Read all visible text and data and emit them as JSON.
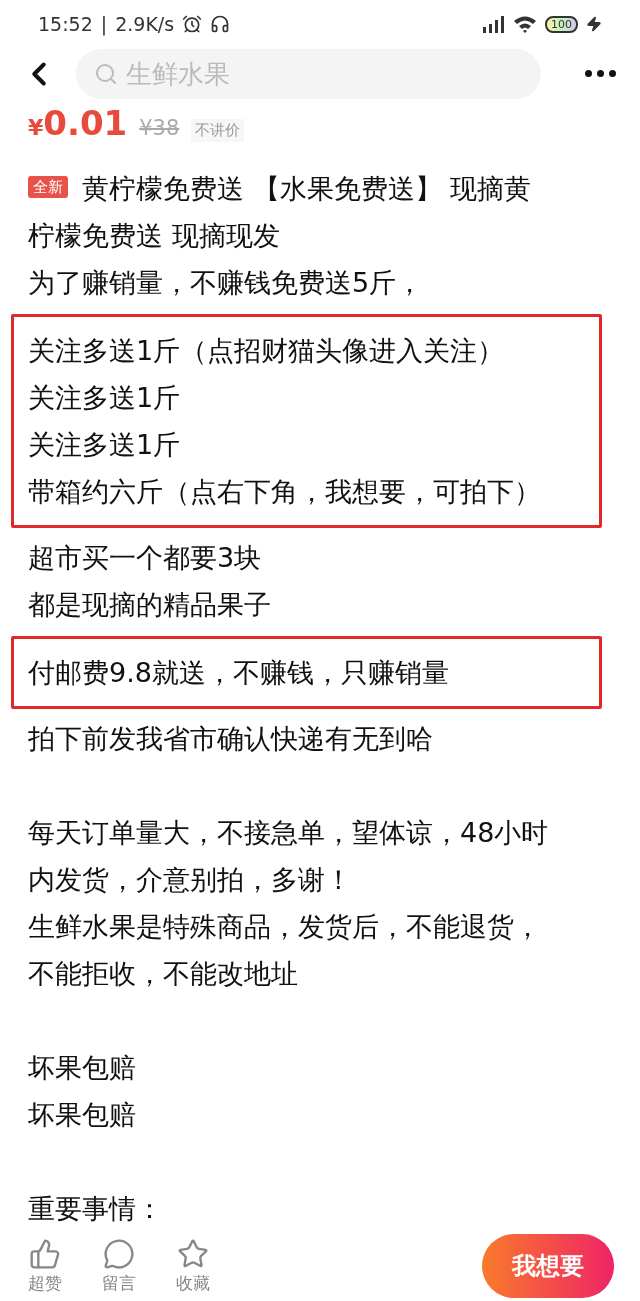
{
  "status_bar": {
    "time": "15:52",
    "separator": "|",
    "speed": "2.9K/s",
    "battery": "100"
  },
  "header": {
    "search": {
      "placeholder": "生鲜水果"
    }
  },
  "price": {
    "current_symbol": "¥",
    "current": "0.01",
    "original": "¥38",
    "tag": "不讲价"
  },
  "title": {
    "badge": "全新",
    "lines": [
      "黄柠檬免费送 【水果免费送】 现摘黄",
      "柠檬免费送  现摘现发"
    ]
  },
  "description": [
    {
      "blocks": [
        {
          "boxed": false,
          "lines": [
            "为了赚销量，不赚钱免费送5斤，"
          ]
        },
        {
          "boxed": true,
          "lines": [
            "关注多送1斤（点招财猫头像进入关注）",
            "关注多送1斤",
            "关注多送1斤",
            "带箱约六斤（点右下角，我想要，可拍下）"
          ]
        },
        {
          "boxed": false,
          "lines": [
            "超市买一个都要3块",
            "都是现摘的精品果子"
          ]
        },
        {
          "boxed": true,
          "lines": [
            "付邮费9.8就送，不赚钱，只赚销量"
          ]
        },
        {
          "boxed": false,
          "lines": [
            "拍下前发我省市确认快递有无到哈"
          ]
        }
      ]
    },
    {
      "blocks": [
        {
          "boxed": false,
          "lines": [
            "每天订单量大，不接急单，望体谅，48小时",
            "内发货，介意别拍，多谢！",
            "生鲜水果是特殊商品，发货后，不能退货，",
            "不能拒收，不能改地址"
          ]
        }
      ]
    },
    {
      "blocks": [
        {
          "boxed": false,
          "lines": [
            "坏果包赔",
            "坏果包赔"
          ]
        }
      ]
    },
    {
      "blocks": [
        {
          "boxed": false,
          "lines": [
            "重要事情："
          ]
        }
      ]
    }
  ],
  "bottom_bar": {
    "actions": [
      {
        "kind": "like",
        "label": "超赞"
      },
      {
        "kind": "comment",
        "label": "留言"
      },
      {
        "kind": "favorite",
        "label": "收藏"
      }
    ],
    "buy_button": "我想要"
  }
}
